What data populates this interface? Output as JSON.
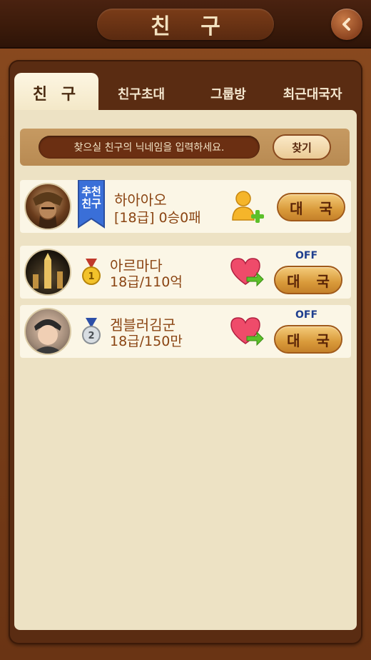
{
  "header": {
    "title": "친 구"
  },
  "tabs": [
    {
      "label": "친 구",
      "active": true
    },
    {
      "label": "친구초대",
      "active": false
    },
    {
      "label": "그룹방",
      "active": false
    },
    {
      "label": "최근대국자",
      "active": false
    }
  ],
  "search": {
    "placeholder": "찾으실 친구의 닉네임을 입력하세요.",
    "button": "찾기"
  },
  "friends": [
    {
      "badge": "추천\n친구",
      "name": "하아아오",
      "detail": "[18급]  0승0패",
      "action_icon": "add-friend-icon",
      "status": "",
      "button": "대 국"
    },
    {
      "medal": "1",
      "name": "아르마다",
      "detail": "18급/110억",
      "action_icon": "heart-send-icon",
      "status": "OFF",
      "button": "대 국"
    },
    {
      "medal": "2",
      "name": "겜블러김군",
      "detail": "18급/150만",
      "action_icon": "heart-send-icon",
      "status": "OFF",
      "button": "대 국"
    }
  ],
  "colors": {
    "accent": "#8a4412",
    "frame": "#5a2c12",
    "panel": "#ede2c4",
    "off": "#1f3f8f"
  }
}
